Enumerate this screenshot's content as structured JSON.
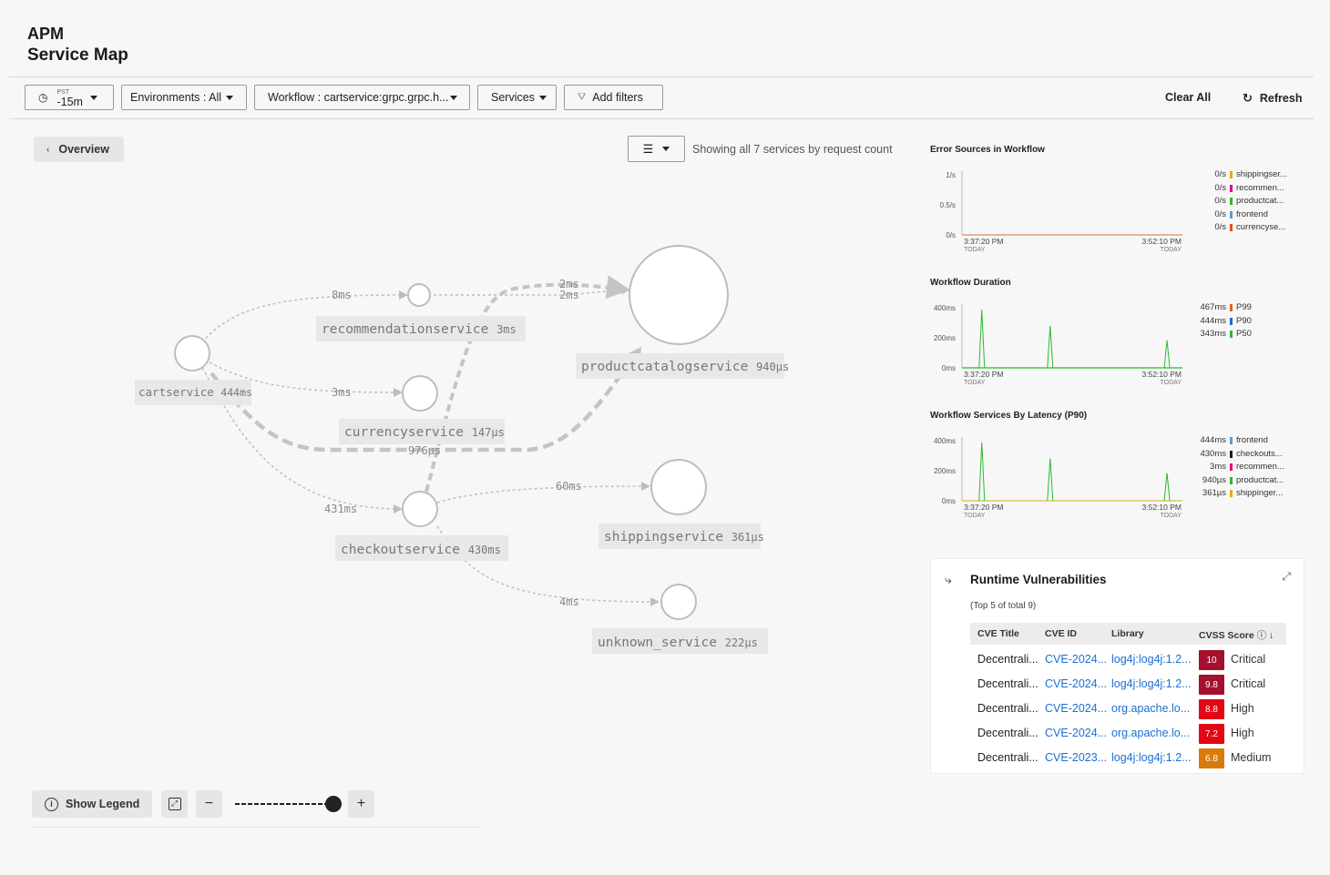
{
  "header": {
    "app": "APM",
    "page": "Service Map"
  },
  "filters": {
    "time_zone": "PST",
    "time_range": "-15m",
    "environments": "Environments : All",
    "workflow": "Workflow : cartservice:grpc.grpc.h...",
    "services": "Services",
    "add_filters": "Add filters",
    "clear_all": "Clear All",
    "refresh": "Refresh"
  },
  "map": {
    "overview_label": "Overview",
    "showing_text": "Showing all 7 services by request count",
    "nodes": [
      {
        "name": "cartservice",
        "latency": "444ms"
      },
      {
        "name": "recommendationservice",
        "latency": "3ms"
      },
      {
        "name": "currencyservice",
        "latency": "147µs"
      },
      {
        "name": "productcatalogservice",
        "latency": "940µs"
      },
      {
        "name": "checkoutservice",
        "latency": "430ms"
      },
      {
        "name": "shippingservice",
        "latency": "361µs"
      },
      {
        "name": "unknown_service",
        "latency": "222µs"
      }
    ],
    "edges": [
      {
        "from": "cartservice",
        "to": "recommendationservice",
        "label": "8ms"
      },
      {
        "from": "cartservice",
        "to": "currencyservice",
        "label": "3ms"
      },
      {
        "from": "cartservice",
        "to": "productcatalogservice",
        "label": "976µs"
      },
      {
        "from": "cartservice",
        "to": "checkoutservice",
        "label": "431ms"
      },
      {
        "from": "checkoutservice",
        "to": "productcatalogservice",
        "label": "2ms"
      },
      {
        "from": "recommendationservice",
        "to": "productcatalogservice",
        "label": "2ms"
      },
      {
        "from": "checkoutservice",
        "to": "shippingservice",
        "label": "60ms"
      },
      {
        "from": "checkoutservice",
        "to": "unknown_service",
        "label": "4ms"
      }
    ]
  },
  "bottom_bar": {
    "show_legend": "Show Legend",
    "zoom_out": "−",
    "zoom_in": "+"
  },
  "error_sources": {
    "title": "Error Sources in Workflow",
    "y_ticks": [
      "1/s",
      "0.5/s",
      "0/s"
    ],
    "x_start": "3:37:20 PM",
    "x_end": "3:52:10 PM",
    "x_sub": "TODAY",
    "legend": [
      {
        "value": "0/s",
        "name": "shippingser...",
        "color": "#f2a900"
      },
      {
        "value": "0/s",
        "name": "recommen...",
        "color": "#e6007e"
      },
      {
        "value": "0/s",
        "name": "productcat...",
        "color": "#2db82d"
      },
      {
        "value": "0/s",
        "name": "frontend",
        "color": "#5b9bd5"
      },
      {
        "value": "0/s",
        "name": "currencyse...",
        "color": "#d9541e"
      }
    ]
  },
  "workflow_duration": {
    "title": "Workflow Duration",
    "y_ticks": [
      "400ms",
      "200ms",
      "0ms"
    ],
    "x_start": "3:37:20 PM",
    "x_end": "3:52:10 PM",
    "x_sub": "TODAY",
    "legend": [
      {
        "value": "467ms",
        "name": "P99",
        "color": "#e8621c"
      },
      {
        "value": "444ms",
        "name": "P90",
        "color": "#1a6fd4"
      },
      {
        "value": "343ms",
        "name": "P50",
        "color": "#2db82d"
      }
    ]
  },
  "services_latency": {
    "title": "Workflow Services By Latency (P90)",
    "y_ticks": [
      "400ms",
      "200ms",
      "0ms"
    ],
    "x_start": "3:37:20 PM",
    "x_end": "3:52:10 PM",
    "x_sub": "TODAY",
    "legend": [
      {
        "value": "444ms",
        "name": "frontend",
        "color": "#5b9bd5"
      },
      {
        "value": "430ms",
        "name": "checkouts...",
        "color": "#1a1a1a"
      },
      {
        "value": "3ms",
        "name": "recommen...",
        "color": "#e6007e"
      },
      {
        "value": "940µs",
        "name": "productcat...",
        "color": "#2db82d"
      },
      {
        "value": "361µs",
        "name": "shippinger...",
        "color": "#f2a900"
      }
    ]
  },
  "vulnerabilities": {
    "title": "Runtime Vulnerabilities",
    "subtitle": "(Top 5 of total 9)",
    "columns": [
      "CVE Title",
      "CVE ID",
      "Library",
      "CVSS Score"
    ],
    "rows": [
      {
        "title": "Decentrali...",
        "cve": "CVE-2024...",
        "library": "log4j:log4j:1.2...",
        "score": "10",
        "severity": "Critical",
        "color": "#a3112e"
      },
      {
        "title": "Decentrali...",
        "cve": "CVE-2024...",
        "library": "log4j:log4j:1.2...",
        "score": "9.8",
        "severity": "Critical",
        "color": "#a3112e"
      },
      {
        "title": "Decentrali...",
        "cve": "CVE-2024...",
        "library": "org.apache.lo...",
        "score": "8.8",
        "severity": "High",
        "color": "#e30613"
      },
      {
        "title": "Decentrali...",
        "cve": "CVE-2024...",
        "library": "org.apache.lo...",
        "score": "7.2",
        "severity": "High",
        "color": "#e30613"
      },
      {
        "title": "Decentrali...",
        "cve": "CVE-2023...",
        "library": "log4j:log4j:1.2...",
        "score": "6.8",
        "severity": "Medium",
        "color": "#d97a0a"
      }
    ]
  }
}
